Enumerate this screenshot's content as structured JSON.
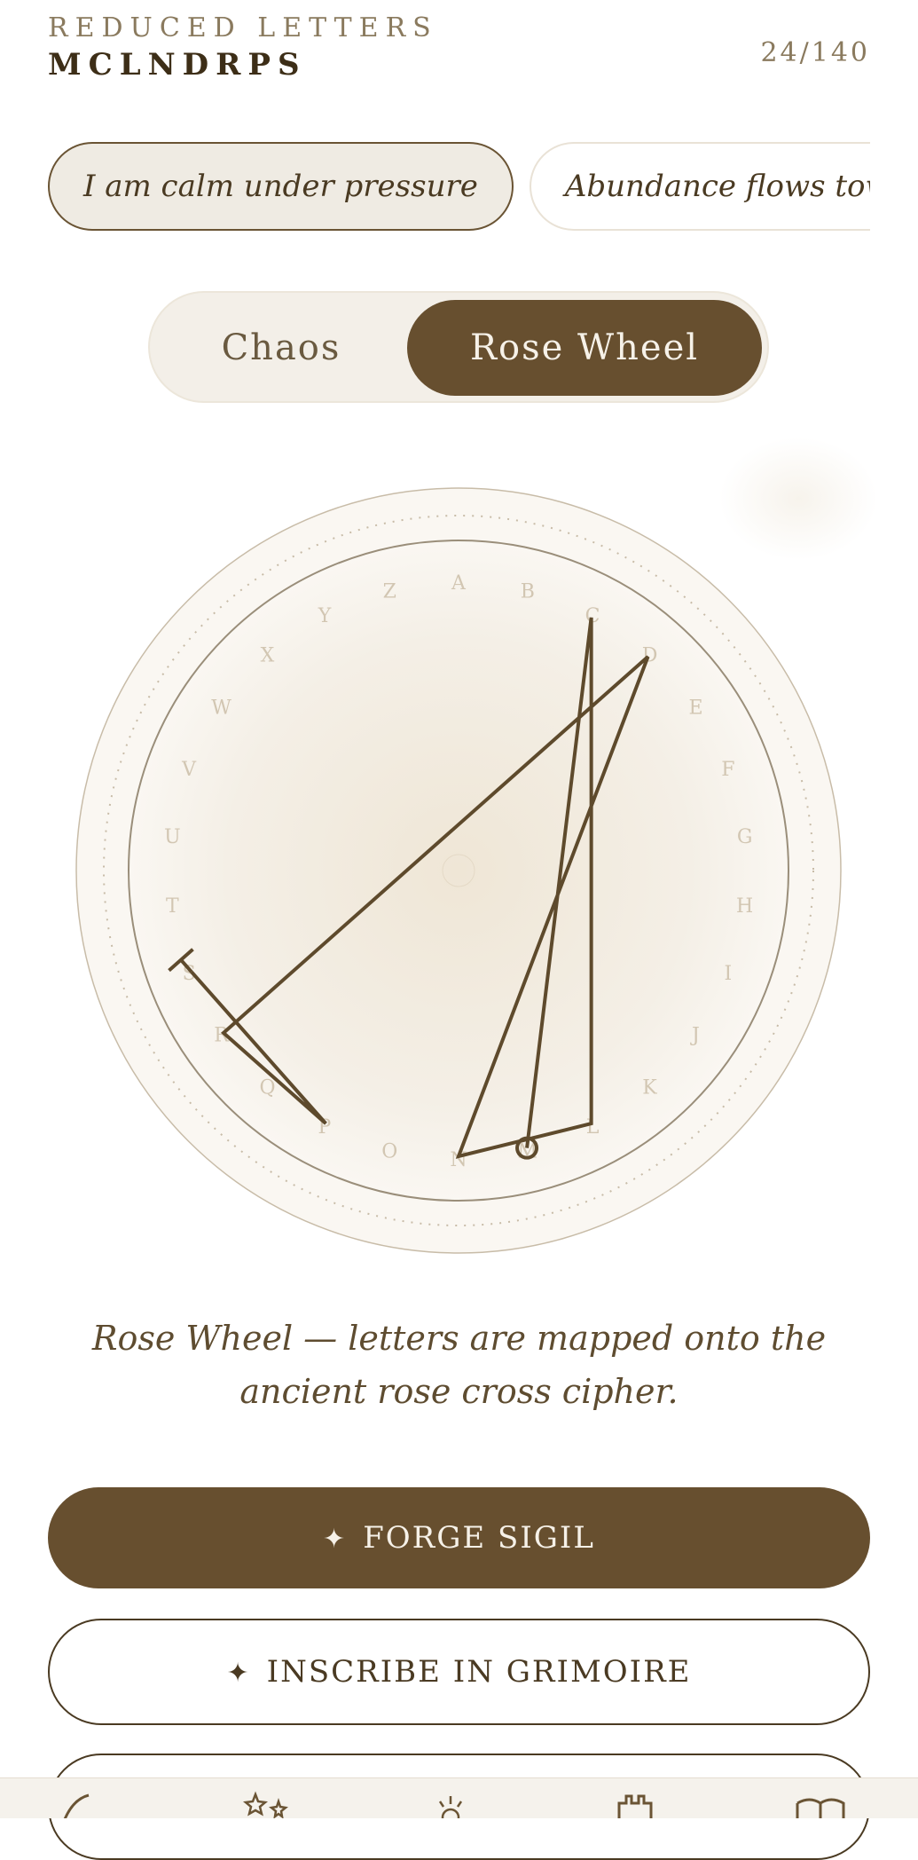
{
  "header": {
    "kicker": "REDUCED LETTERS",
    "letters": "MCLNDRPS",
    "count": "24/140"
  },
  "chips": [
    {
      "label": "I am calm under pressure",
      "selected": true
    },
    {
      "label": "Abundance flows toward me",
      "selected": false
    }
  ],
  "mode_toggle": {
    "options": [
      "Chaos",
      "Rose Wheel"
    ],
    "selected": "Rose Wheel"
  },
  "wheel": {
    "letters": [
      "A",
      "B",
      "C",
      "D",
      "E",
      "F",
      "G",
      "H",
      "I",
      "J",
      "K",
      "L",
      "M",
      "N",
      "O",
      "P",
      "Q",
      "R",
      "S",
      "T",
      "U",
      "V",
      "W",
      "X",
      "Y",
      "Z"
    ],
    "sigil_path": [
      "M",
      "C",
      "L",
      "N",
      "D",
      "R",
      "P",
      "S"
    ]
  },
  "caption": "Rose Wheel — letters are mapped onto the ancient rose cross cipher.",
  "actions": {
    "forge_label": "FORGE SIGIL",
    "inscribe_label": "INSCRIBE IN GRIMOIRE"
  },
  "tabbar": {
    "icons": [
      "feather-icon",
      "stars-icon",
      "sun-icon",
      "tower-icon",
      "book-icon"
    ]
  },
  "colors": {
    "accent": "#674f2f",
    "ink": "#4a3a22",
    "parchment": "#f3efe8"
  }
}
